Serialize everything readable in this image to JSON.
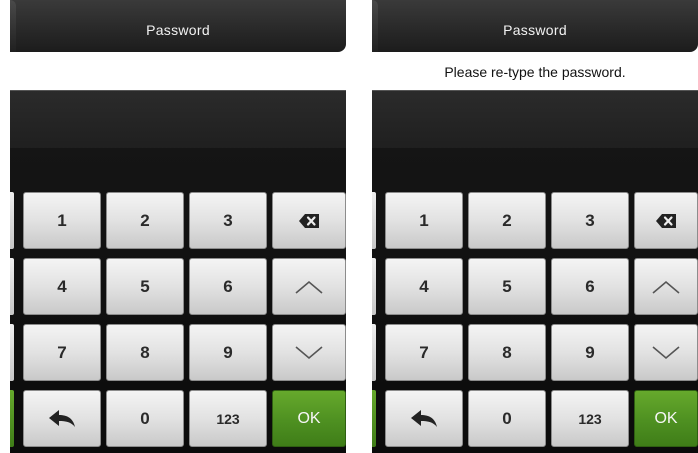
{
  "screens": [
    {
      "title": "Password",
      "prompt": "",
      "keys": {
        "k1": "1",
        "k2": "2",
        "k3": "3",
        "k4": "4",
        "k5": "5",
        "k6": "6",
        "k7": "7",
        "k8": "8",
        "k9": "9",
        "k0": "0",
        "mode": "123",
        "ok": "OK"
      },
      "icons": {
        "backspace": "backspace-icon",
        "up": "chevron-up-icon",
        "down": "chevron-down-icon",
        "back": "back-arrow-icon"
      }
    },
    {
      "title": "Password",
      "prompt": "Please re-type the password.",
      "keys": {
        "k1": "1",
        "k2": "2",
        "k3": "3",
        "k4": "4",
        "k5": "5",
        "k6": "6",
        "k7": "7",
        "k8": "8",
        "k9": "9",
        "k0": "0",
        "mode": "123",
        "ok": "OK"
      },
      "icons": {
        "backspace": "backspace-icon",
        "up": "chevron-up-icon",
        "down": "chevron-down-icon",
        "back": "back-arrow-icon"
      }
    }
  ],
  "colors": {
    "ok_green": "#4e9021",
    "titlebar": "#2a2a2a",
    "key_face": "#e2e2e2"
  }
}
